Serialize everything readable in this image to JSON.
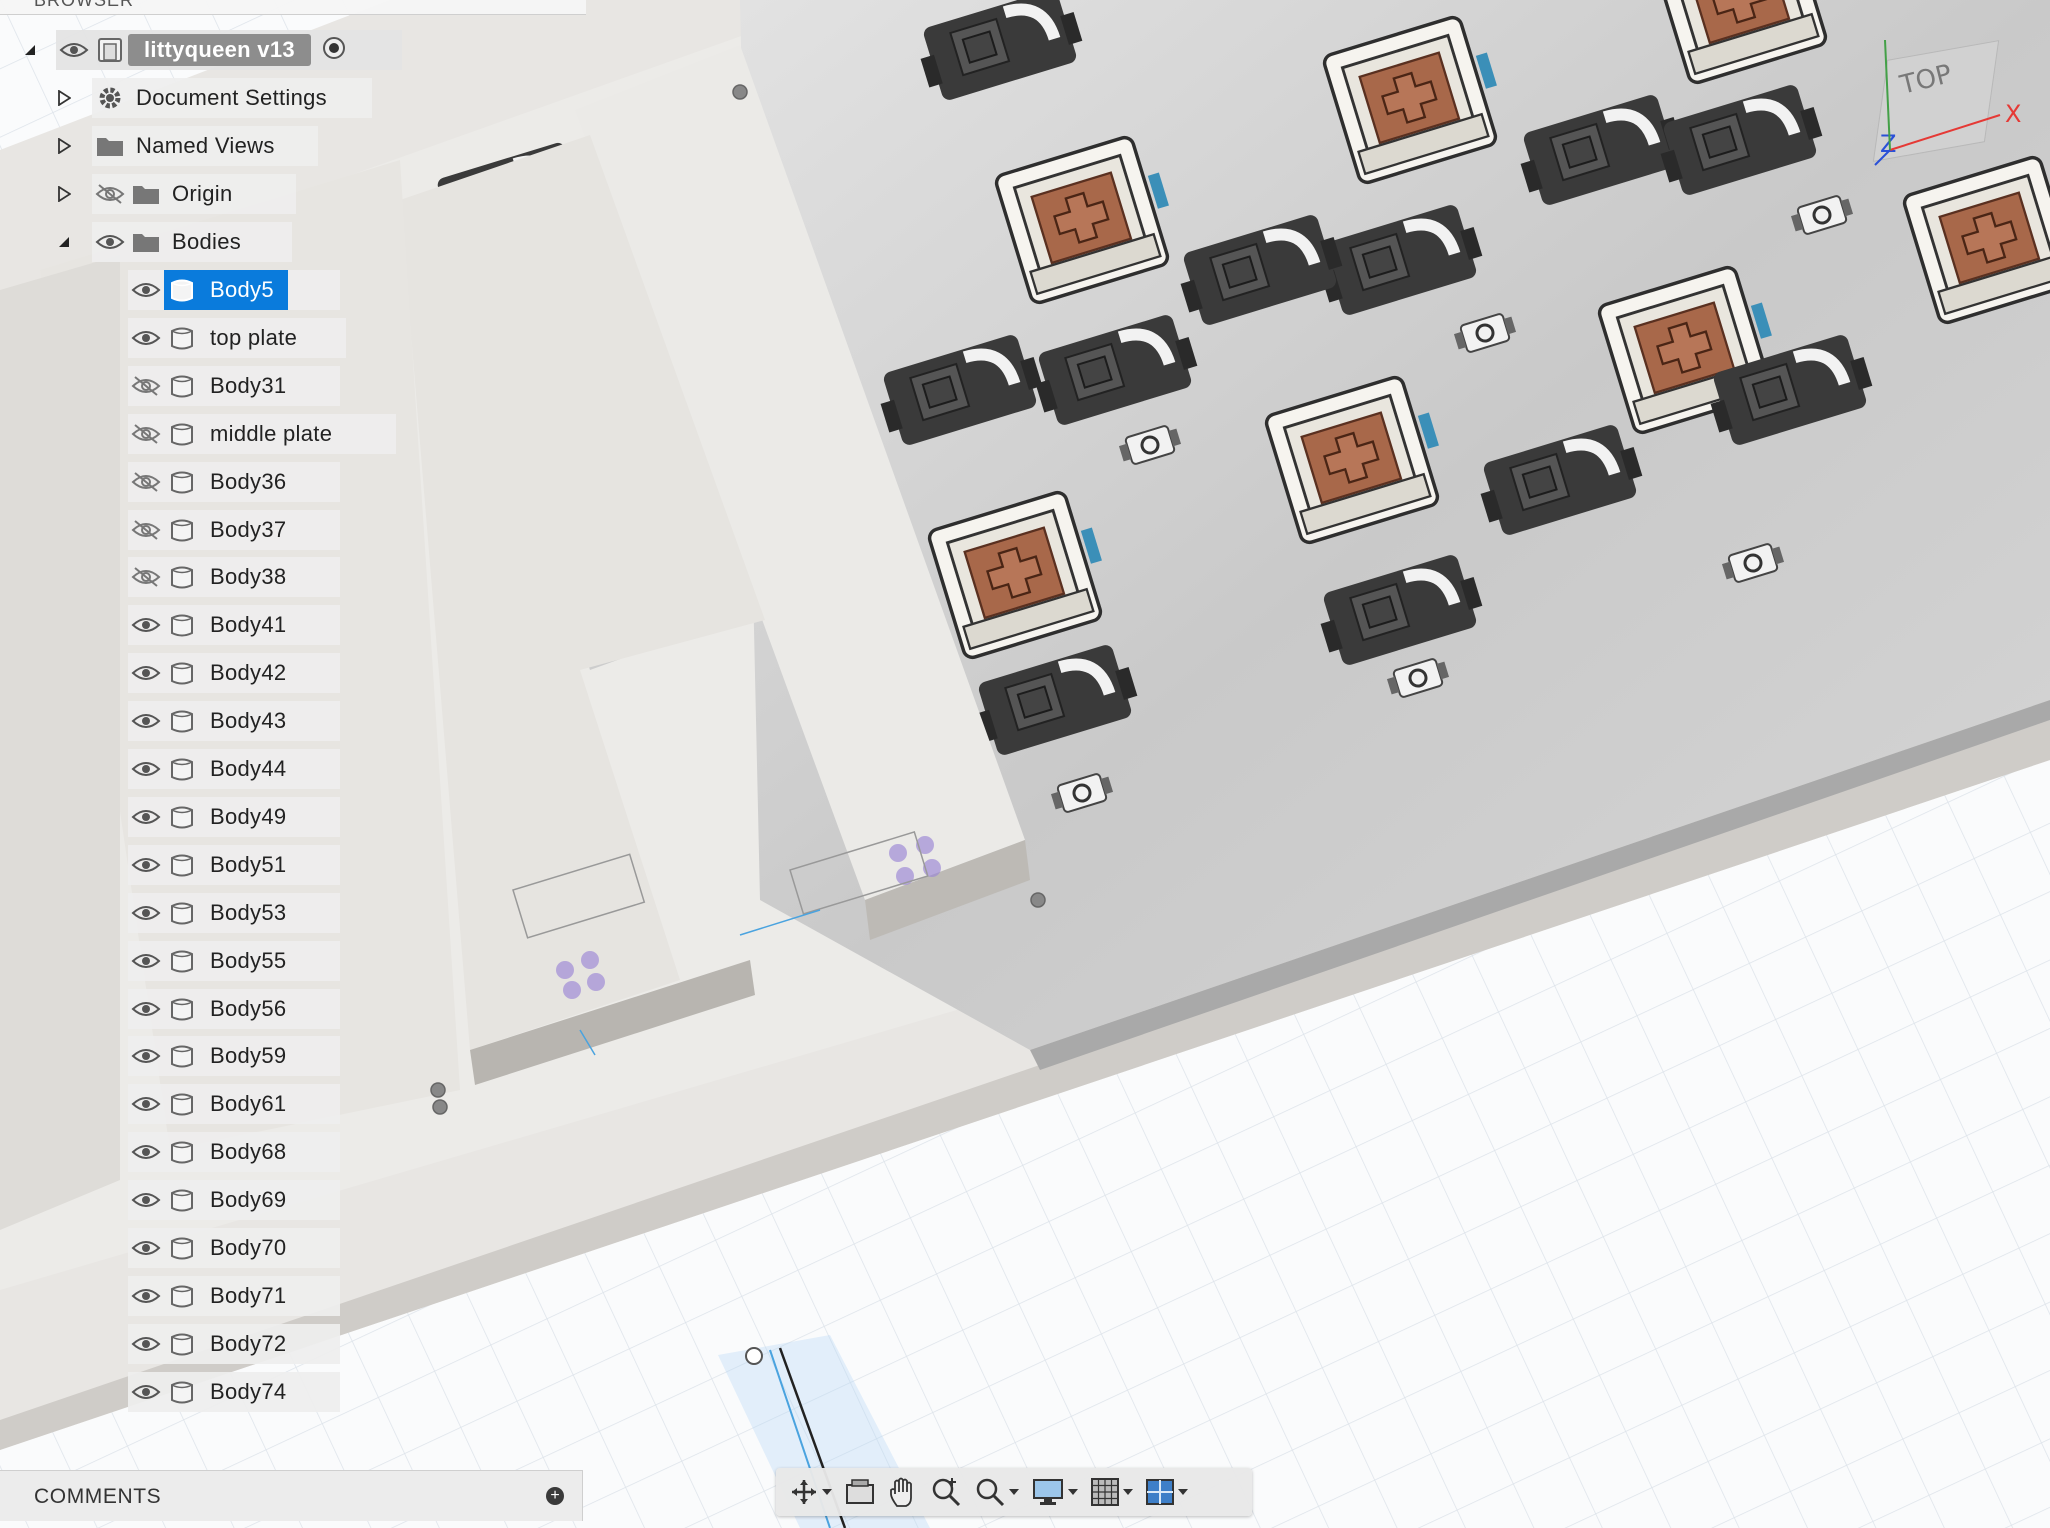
{
  "browser": {
    "header": "BROWSER",
    "root": {
      "label": "littyqueen v13"
    },
    "folders": [
      {
        "label": "Document Settings",
        "icon": "gear-icon"
      },
      {
        "label": "Named Views",
        "icon": "folder-icon"
      },
      {
        "label": "Origin",
        "icon": "folder-icon",
        "visible": false
      },
      {
        "label": "Bodies",
        "icon": "folder-icon",
        "visible": true
      }
    ],
    "bodies": [
      {
        "label": "Body5",
        "visible": true,
        "selected": true
      },
      {
        "label": "top plate",
        "visible": true
      },
      {
        "label": "Body31",
        "visible": false
      },
      {
        "label": "middle plate",
        "visible": false
      },
      {
        "label": "Body36",
        "visible": false
      },
      {
        "label": "Body37",
        "visible": false
      },
      {
        "label": "Body38",
        "visible": false
      },
      {
        "label": "Body41",
        "visible": true
      },
      {
        "label": "Body42",
        "visible": true
      },
      {
        "label": "Body43",
        "visible": true
      },
      {
        "label": "Body44",
        "visible": true
      },
      {
        "label": "Body49",
        "visible": true
      },
      {
        "label": "Body51",
        "visible": true
      },
      {
        "label": "Body53",
        "visible": true
      },
      {
        "label": "Body55",
        "visible": true
      },
      {
        "label": "Body56",
        "visible": true
      },
      {
        "label": "Body59",
        "visible": true
      },
      {
        "label": "Body61",
        "visible": true
      },
      {
        "label": "Body68",
        "visible": true
      },
      {
        "label": "Body69",
        "visible": true
      },
      {
        "label": "Body70",
        "visible": true
      },
      {
        "label": "Body71",
        "visible": true
      },
      {
        "label": "Body72",
        "visible": true
      },
      {
        "label": "Body74",
        "visible": true
      }
    ]
  },
  "comments": {
    "title": "COMMENTS"
  },
  "viewcube": {
    "face_label": "TOP",
    "x_axis": "X",
    "z_axis": "Z"
  },
  "navbar": {
    "tools": [
      {
        "icon": "orbit-icon",
        "dropdown": true
      },
      {
        "icon": "look-at-icon",
        "dropdown": false
      },
      {
        "icon": "pan-hand-icon",
        "dropdown": false
      },
      {
        "icon": "zoom-icon",
        "dropdown": false
      },
      {
        "icon": "fit-zoom-icon",
        "dropdown": true
      },
      {
        "icon": "display-settings-icon",
        "dropdown": true
      },
      {
        "icon": "grid-icon",
        "dropdown": true
      },
      {
        "icon": "viewports-icon",
        "dropdown": true
      }
    ]
  },
  "colors": {
    "selection": "#0a7bdc",
    "switch_cap": "#a8684a",
    "grid": "#dfe6ee"
  }
}
